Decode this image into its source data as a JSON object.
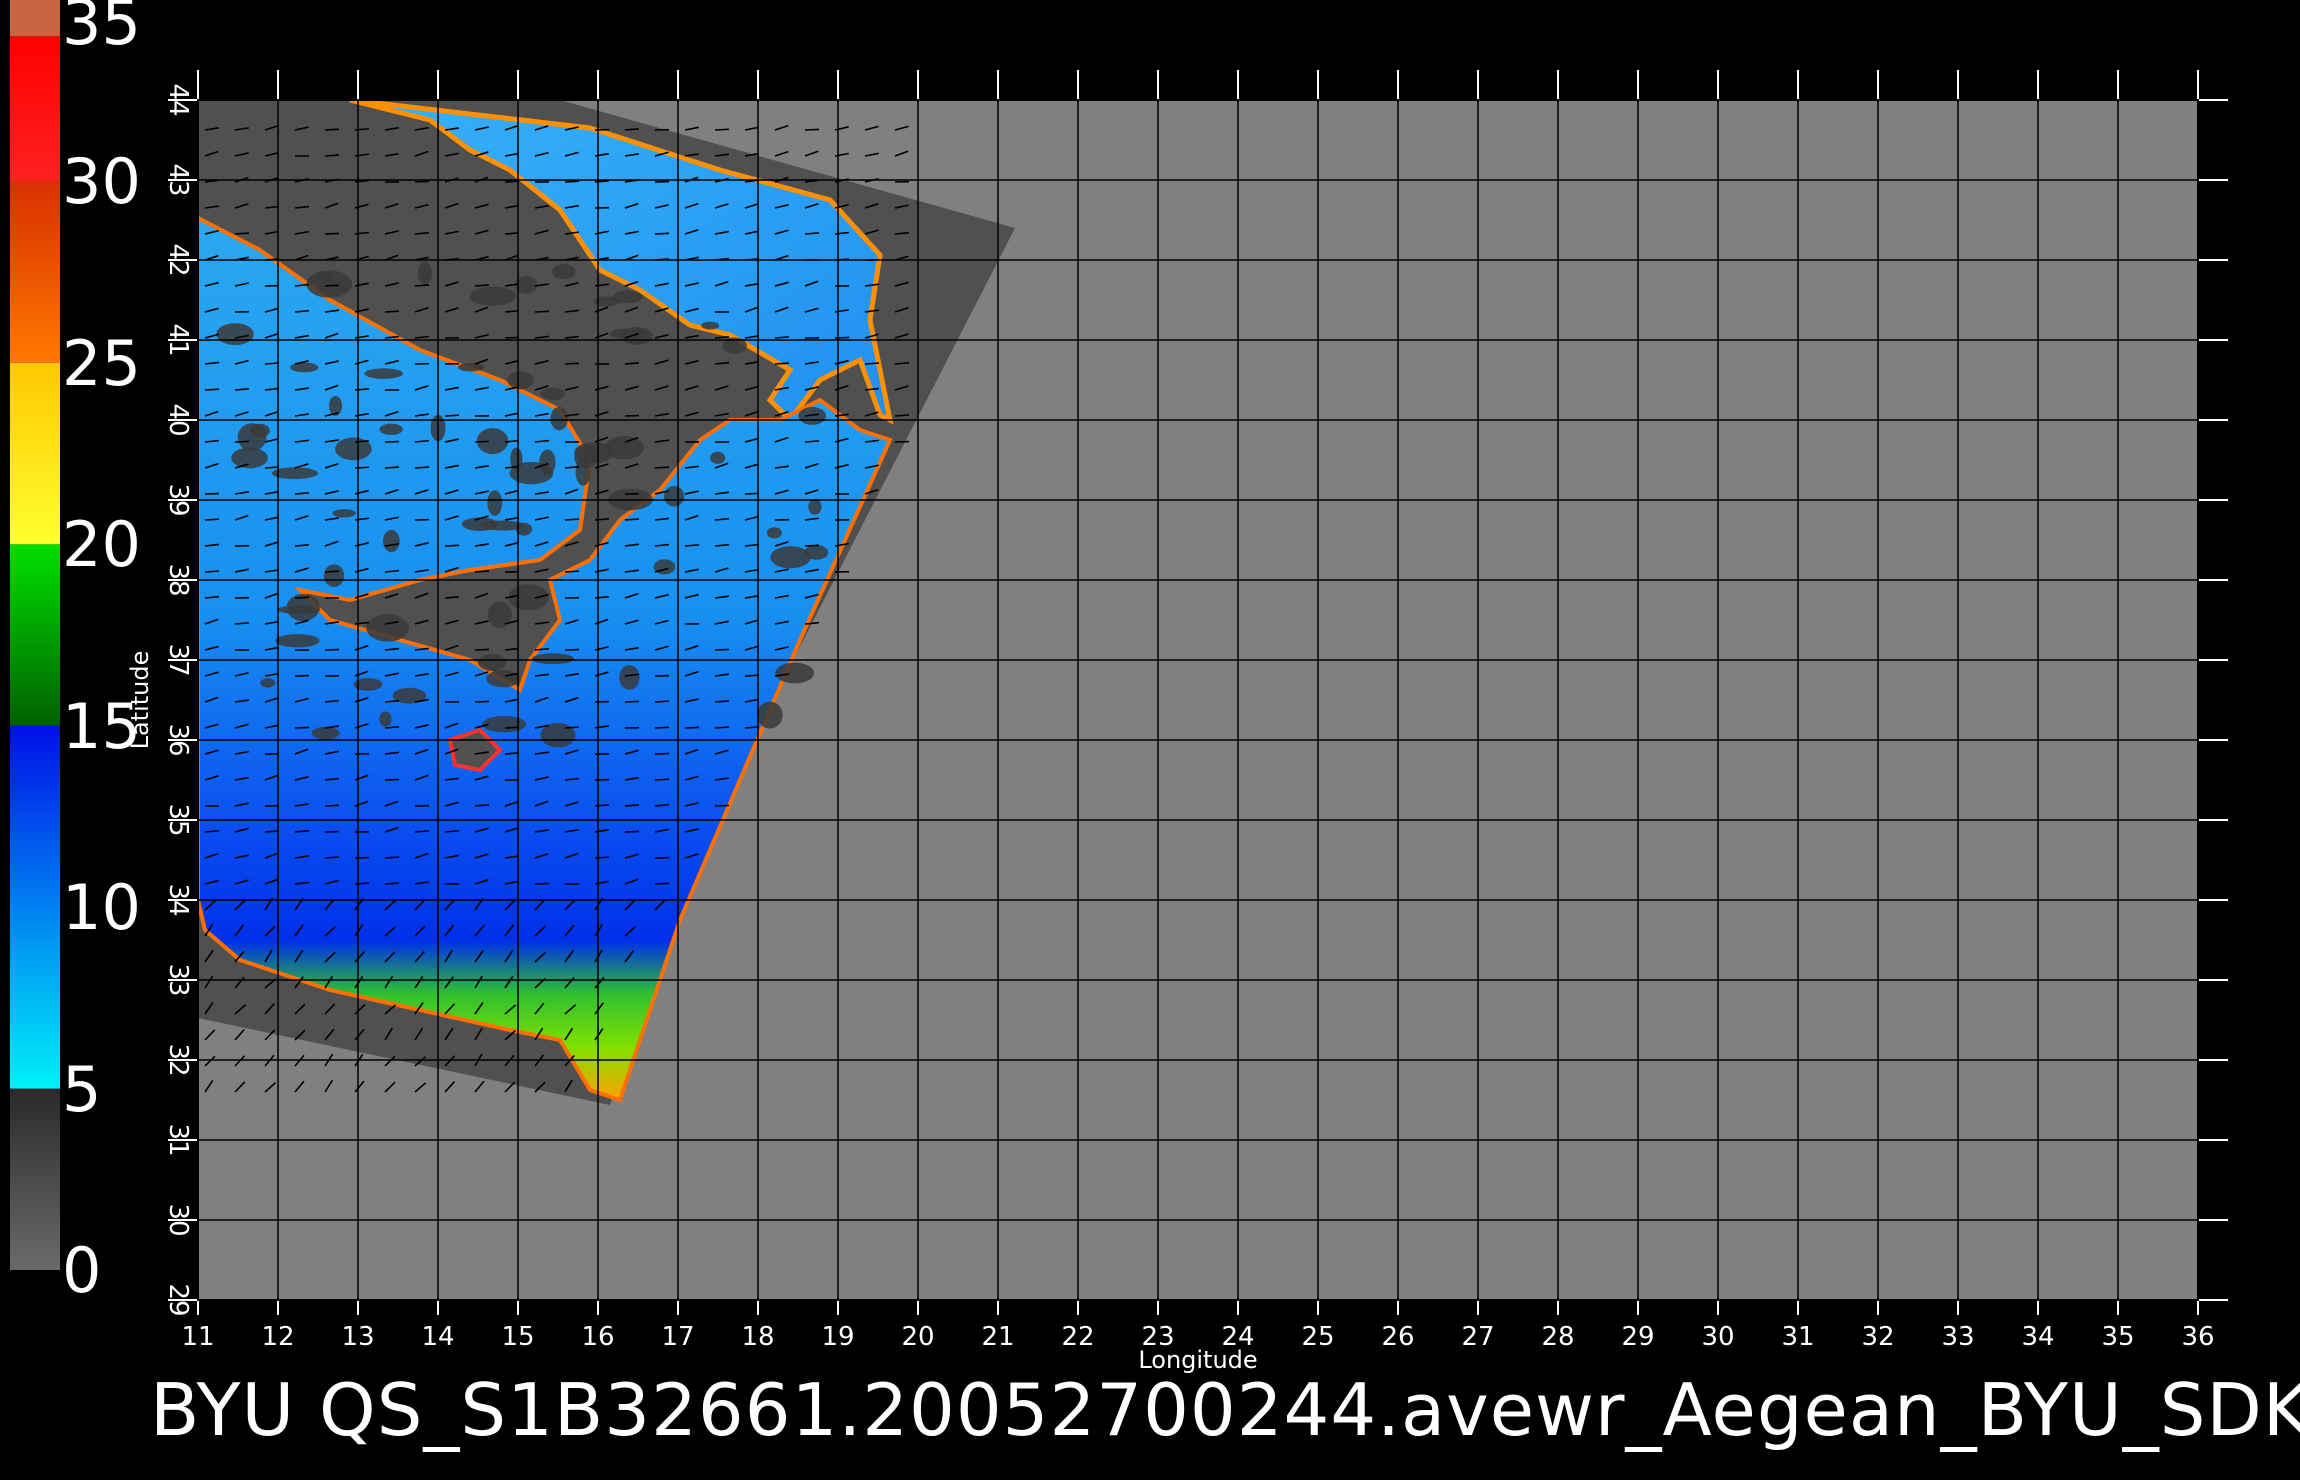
{
  "colorbar": {
    "labels": [
      "35",
      "30",
      "25",
      "20",
      "15",
      "10",
      "5",
      "0"
    ],
    "stops": [
      {
        "from": 0,
        "to": 5,
        "colors": [
          "#6a6a6a",
          "#2a2a2a"
        ]
      },
      {
        "from": 5,
        "to": 15,
        "colors": [
          "#00f0f8",
          "#0010e8"
        ]
      },
      {
        "from": 15,
        "to": 20,
        "colors": [
          "#006000",
          "#00e000"
        ]
      },
      {
        "from": 20,
        "to": 25,
        "colors": [
          "#ffff30",
          "#ffc800"
        ]
      },
      {
        "from": 25,
        "to": 30,
        "colors": [
          "#ff7800",
          "#d83000"
        ]
      },
      {
        "from": 30,
        "to": 34,
        "colors": [
          "#ff2020",
          "#ff0000"
        ]
      },
      {
        "from": 34,
        "to": 35,
        "colors": [
          "#c86440",
          "#c86440"
        ]
      }
    ]
  },
  "map": {
    "x_ticks": [
      "11",
      "12",
      "13",
      "14",
      "15",
      "16",
      "17",
      "18",
      "19",
      "20",
      "21",
      "22",
      "23",
      "24",
      "25",
      "26",
      "27",
      "28",
      "29",
      "30",
      "31",
      "32",
      "33",
      "34",
      "35",
      "36"
    ],
    "y_ticks": [
      "29",
      "30",
      "31",
      "32",
      "33",
      "34",
      "35",
      "36",
      "37",
      "38",
      "39",
      "40",
      "41",
      "42",
      "43",
      "44"
    ],
    "x_range": [
      11,
      36
    ],
    "y_range": [
      29,
      44
    ],
    "xlabel": "Longitude",
    "ylabel": "Latitude",
    "background_color": "#808080",
    "swath_color": "#505050",
    "grid_color": "#000000"
  },
  "caption": "BYU  QS_S1B32661.20052700244.avewr_Aegean_BYU_SDK"
}
